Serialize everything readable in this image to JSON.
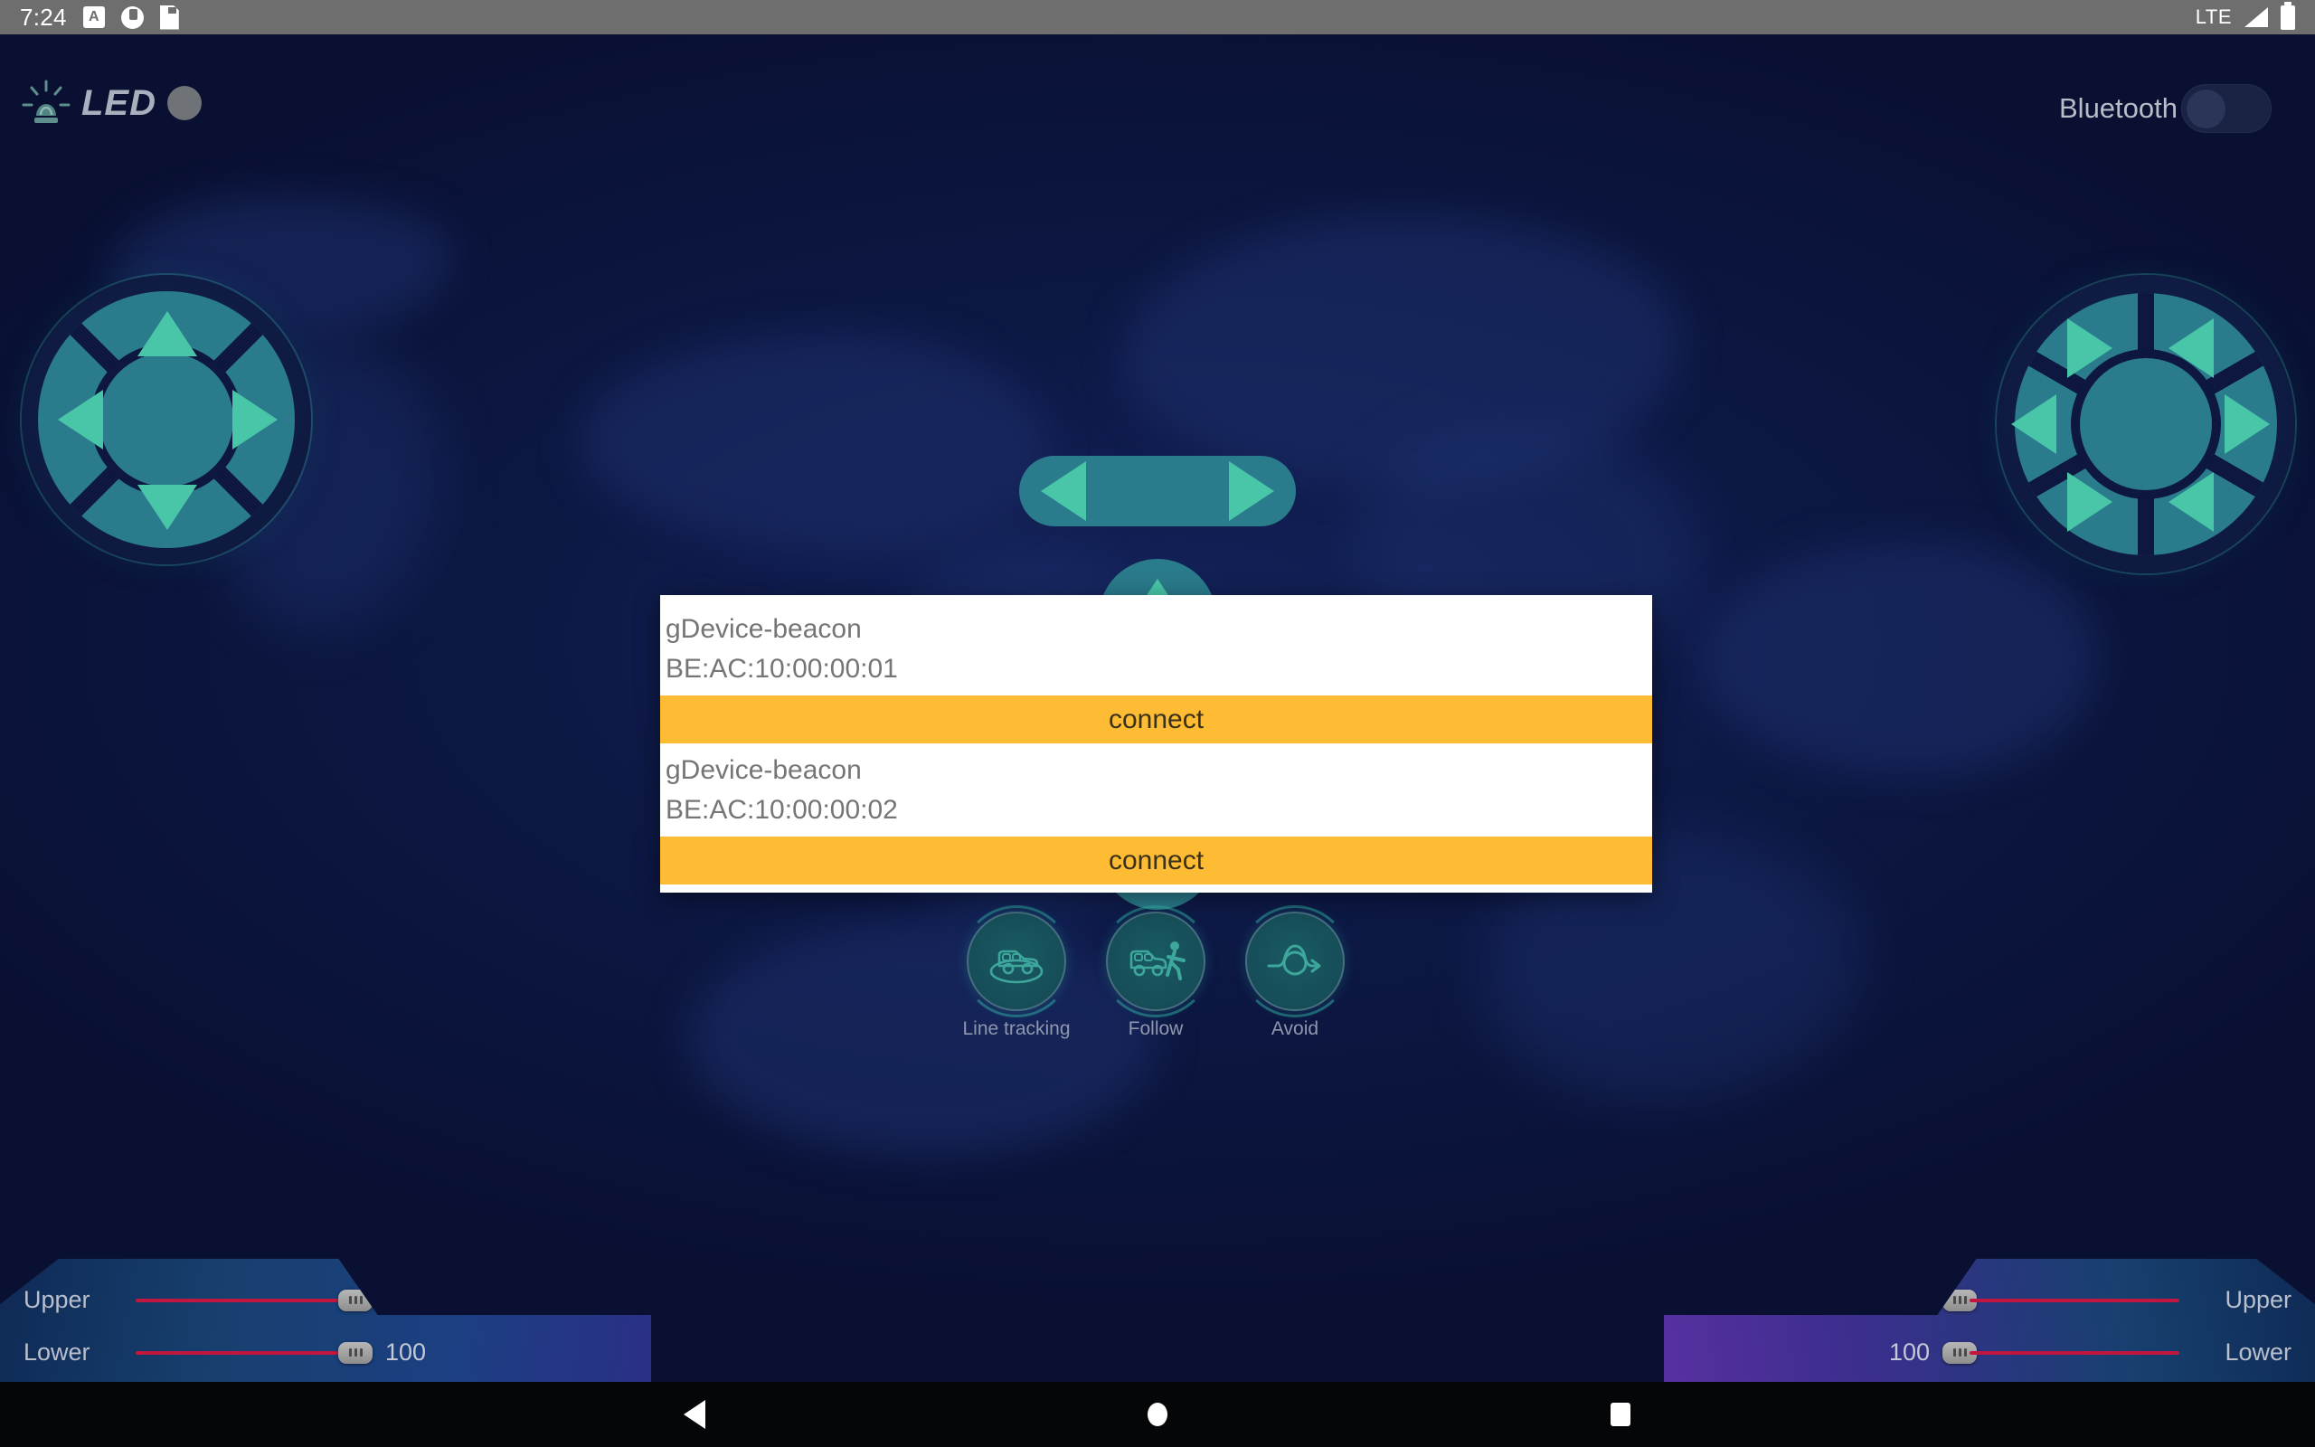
{
  "status_bar": {
    "clock": "7:24",
    "network_type": "LTE",
    "icons": [
      "font-size-a-icon",
      "do-not-disturb-icon",
      "sd-card-icon",
      "signal-bars-icon",
      "battery-icon"
    ]
  },
  "header": {
    "led_label": "LED",
    "led_icon": "siren-beacon-icon",
    "led_indicator_color": "#6f7277",
    "bluetooth_label": "Bluetooth",
    "bluetooth_enabled": false
  },
  "dialog": {
    "visible": true,
    "devices": [
      {
        "name": "gDevice-beacon",
        "address": "BE:AC:10:00:00:01",
        "action_label": "connect"
      },
      {
        "name": "gDevice-beacon",
        "address": "BE:AC:10:00:00:02",
        "action_label": "connect"
      }
    ],
    "accent_color": "#FDBC33",
    "background_color": "#FFFFFF"
  },
  "modes": [
    {
      "label": "Line tracking",
      "icon": "car-on-line-icon"
    },
    {
      "label": "Follow",
      "icon": "car-following-person-icon"
    },
    {
      "label": "Avoid",
      "icon": "obstacle-avoid-arrow-icon"
    }
  ],
  "left_pad": {
    "name": "direction-pad-4way",
    "buttons": [
      "up",
      "left",
      "right",
      "down"
    ]
  },
  "right_pad": {
    "name": "direction-pad-6way",
    "buttons": [
      "upper-left",
      "upper-right",
      "left",
      "right",
      "lower-left",
      "lower-right"
    ]
  },
  "center_controls": {
    "pill": {
      "left_label": "rotate-left",
      "right_label": "rotate-right"
    },
    "circle_top": "forward-button",
    "circle_bottom": "backward-button"
  },
  "sliders": {
    "left": [
      {
        "label": "Upper",
        "value": "100",
        "track_color": "#c0163f"
      },
      {
        "label": "Lower",
        "value": "100",
        "track_color": "#c0163f"
      }
    ],
    "right": [
      {
        "label": "Upper",
        "value": "100",
        "track_color": "#c0163f"
      },
      {
        "label": "Lower",
        "value": "100",
        "track_color": "#c0163f"
      }
    ]
  },
  "nav_bar": {
    "back": "back-triangle-icon",
    "home": "home-circle-icon",
    "recents": "recents-square-icon"
  },
  "theme": {
    "background_deep": "#091032",
    "background_mid": "#13225a",
    "pad_teal": "#2a7b8c",
    "arrow_green": "#49c6a8"
  }
}
